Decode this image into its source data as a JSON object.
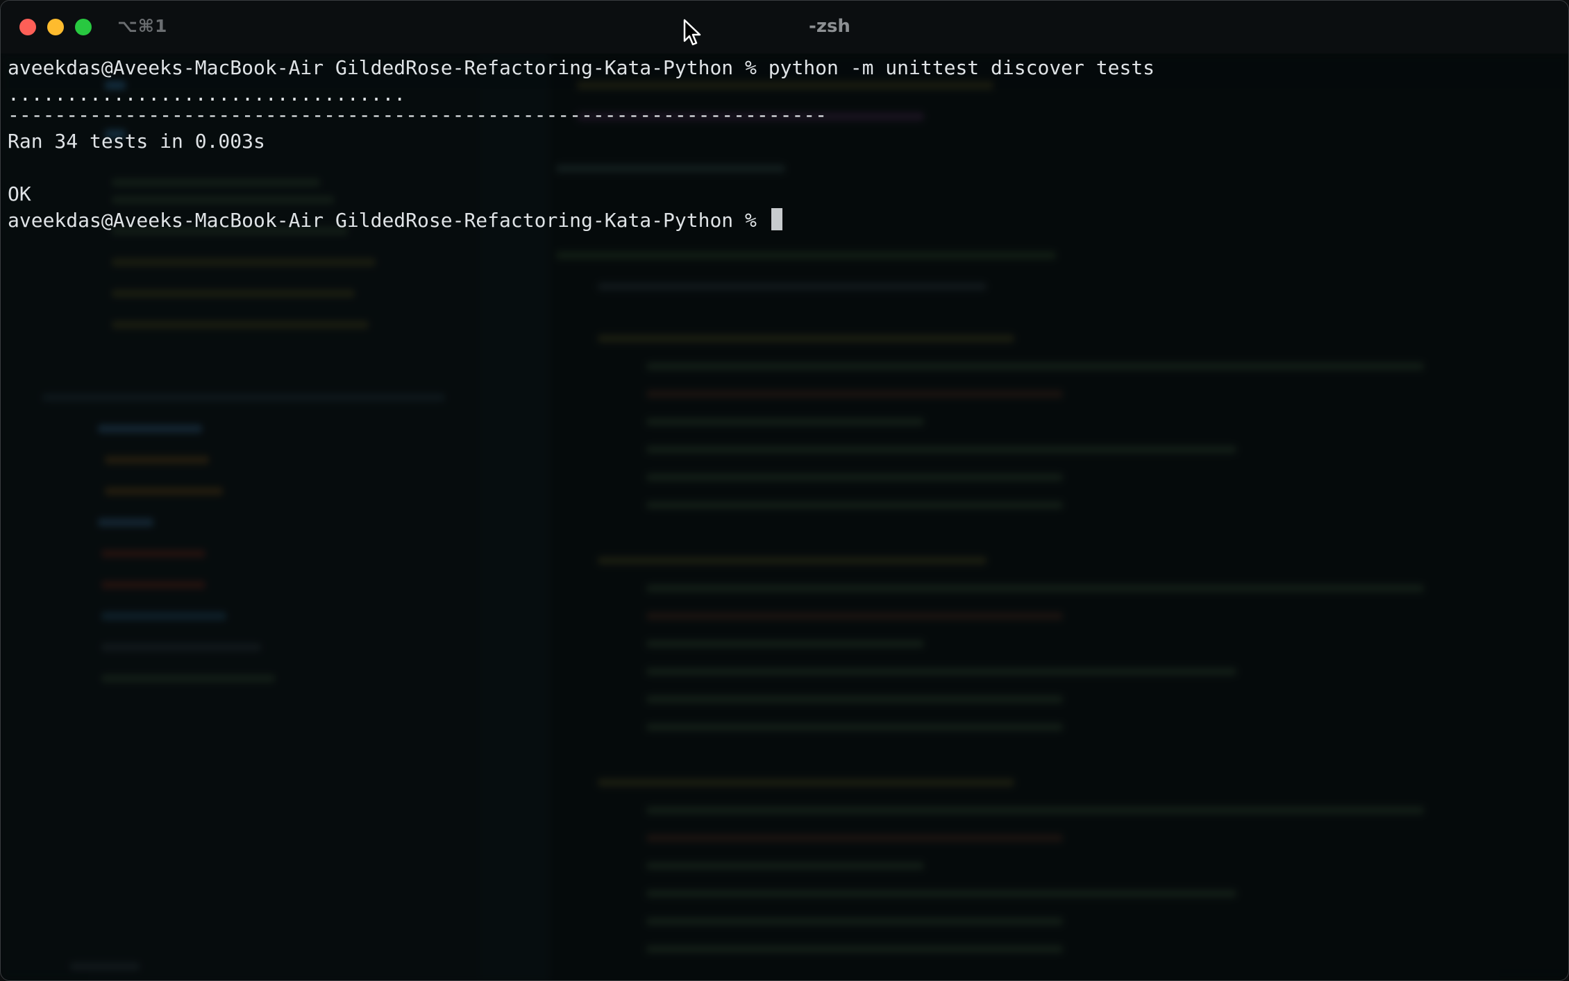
{
  "window": {
    "shortcut": "⌥⌘1",
    "title": "-zsh"
  },
  "terminal": {
    "lines": [
      {
        "prompt": "aveekdas@Aveeks-MacBook-Air GildedRose-Refactoring-Kata-Python % ",
        "command": "python -m unittest discover tests"
      },
      {
        "text": ".................................."
      },
      {
        "text": "----------------------------------------------------------------------"
      },
      {
        "text": "Ran 34 tests in 0.003s"
      },
      {
        "text": ""
      },
      {
        "text": "OK"
      },
      {
        "prompt": "aveekdas@Aveeks-MacBook-Air GildedRose-Refactoring-Kata-Python % ",
        "command": ""
      }
    ]
  },
  "colors": {
    "background": "#060b0c",
    "text": "#dfe3e6",
    "close": "#fe5f57",
    "minimize": "#febb2e",
    "maximize": "#28c840"
  }
}
